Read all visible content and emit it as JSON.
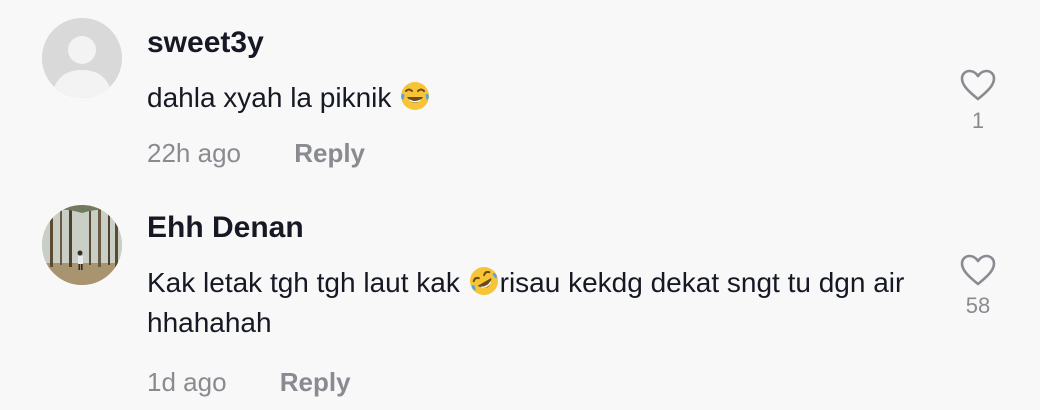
{
  "comments": [
    {
      "username": "sweet3y",
      "text": "dahla xyah la piknik",
      "emoji": "face-with-tears-of-joy",
      "time": "22h ago",
      "reply_label": "Reply",
      "like_count": "1",
      "avatar": "default-avatar"
    },
    {
      "username": "Ehh Denan",
      "text_before_emoji": "Kak letak tgh tgh laut kak ",
      "emoji": "rolling-on-the-floor-laughing",
      "text_after_emoji": "risau kekdg dekat sngt tu dgn air hhahahah",
      "time": "1d ago",
      "reply_label": "Reply",
      "like_count": "58",
      "avatar": "photo-avatar"
    }
  ],
  "colors": {
    "background": "#f8f8f8",
    "primary_text": "#161823",
    "secondary_text": "#8a8b91",
    "emoji_yellow": "#f7c437"
  }
}
